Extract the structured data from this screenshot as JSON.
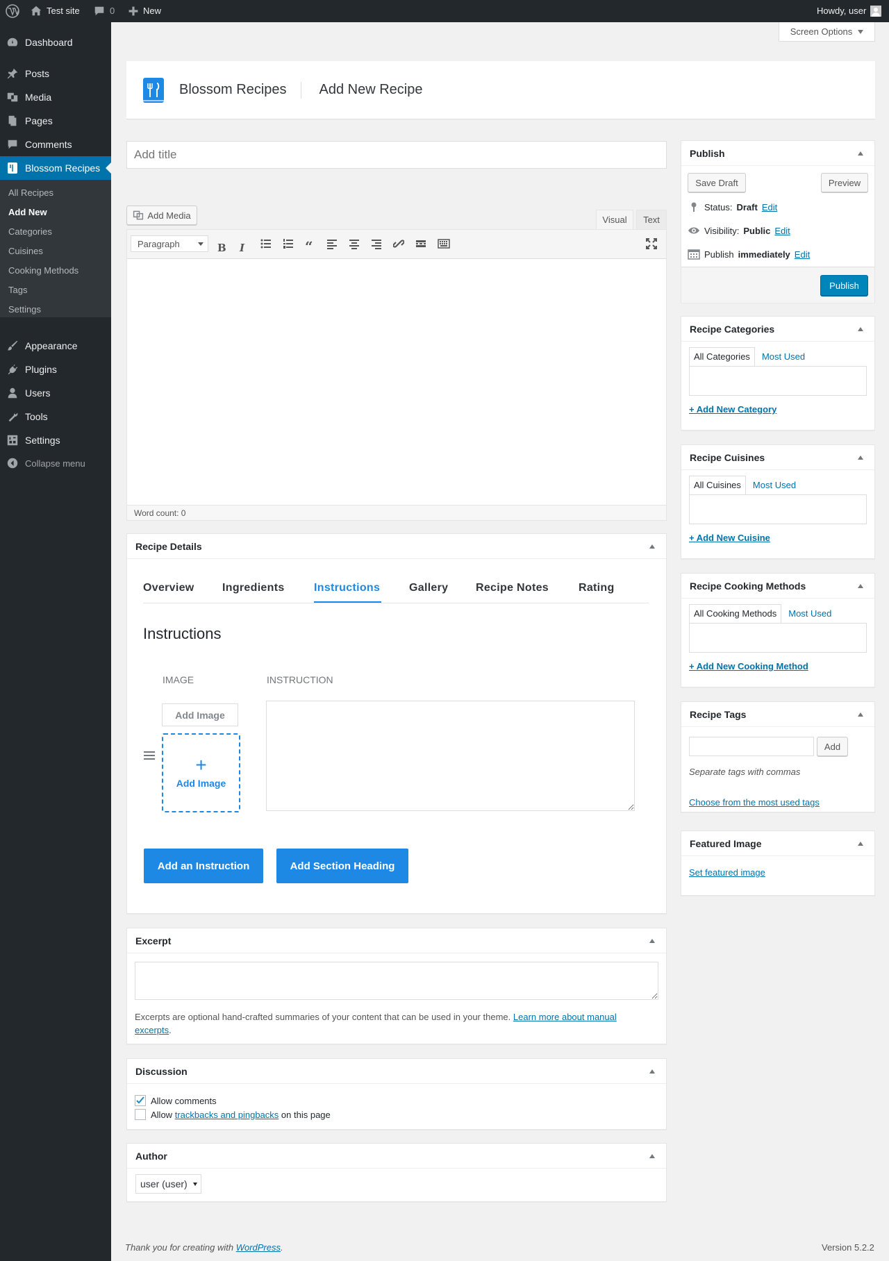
{
  "adminbar": {
    "wp_logo_icon": "wordpress-logo-icon",
    "site_name": "Test site",
    "comments_count": "0",
    "new_label": "New",
    "howdy": "Howdy, user"
  },
  "sidebar": {
    "items": [
      {
        "label": "Dashboard",
        "icon": "dashboard-icon"
      },
      {
        "label": "Posts",
        "icon": "pin-icon"
      },
      {
        "label": "Media",
        "icon": "media-icon"
      },
      {
        "label": "Pages",
        "icon": "pages-icon"
      },
      {
        "label": "Comments",
        "icon": "comments-icon"
      },
      {
        "label": "Blossom Recipes",
        "icon": "recipe-book-icon"
      },
      {
        "label": "Appearance",
        "icon": "brush-icon"
      },
      {
        "label": "Plugins",
        "icon": "plug-icon"
      },
      {
        "label": "Users",
        "icon": "users-icon"
      },
      {
        "label": "Tools",
        "icon": "wrench-icon"
      },
      {
        "label": "Settings",
        "icon": "settings-icon"
      }
    ],
    "submenu": [
      "All Recipes",
      "Add New",
      "Categories",
      "Cuisines",
      "Cooking Methods",
      "Tags",
      "Settings"
    ],
    "collapse": "Collapse menu"
  },
  "screen_options": "Screen Options",
  "header": {
    "plugin_name": "Blossom Recipes",
    "page_title": "Add New Recipe"
  },
  "title_placeholder": "Add title",
  "editor": {
    "add_media": "Add Media",
    "tab_visual": "Visual",
    "tab_text": "Text",
    "format_select": "Paragraph",
    "word_count": "Word count: 0"
  },
  "recipe_details": {
    "heading": "Recipe Details",
    "tabs": [
      "Overview",
      "Ingredients",
      "Instructions",
      "Gallery",
      "Recipe Notes",
      "Rating"
    ],
    "active_tab": "Instructions",
    "section_title": "Instructions",
    "col_image": "IMAGE",
    "col_instruction": "INSTRUCTION",
    "add_image_btn": "Add Image",
    "add_image_box": "Add Image",
    "add_instruction": "Add an Instruction",
    "add_section_heading": "Add Section Heading"
  },
  "excerpt": {
    "heading": "Excerpt",
    "help_text": "Excerpts are optional hand-crafted summaries of your content that can be used in your theme.",
    "link1": "Learn more about manual",
    "link2": "excerpts",
    "period": "."
  },
  "discussion": {
    "heading": "Discussion",
    "allow_comments": "Allow comments",
    "allow_prefix": "Allow",
    "trackbacks_link": "trackbacks and pingbacks",
    "allow_suffix": "on this page",
    "allow_comments_checked": true,
    "allow_pings_checked": false
  },
  "author": {
    "heading": "Author",
    "value": "user (user)"
  },
  "publish": {
    "heading": "Publish",
    "save_draft": "Save Draft",
    "preview": "Preview",
    "status_label": "Status:",
    "status_value": "Draft",
    "visibility_label": "Visibility:",
    "visibility_value": "Public",
    "publish_label": "Publish",
    "publish_value": "immediately",
    "edit": "Edit",
    "publish_btn": "Publish"
  },
  "categories": {
    "heading": "Recipe Categories",
    "tab_all": "All Categories",
    "tab_most": "Most Used",
    "add": "+ Add New Category"
  },
  "cuisines": {
    "heading": "Recipe Cuisines",
    "tab_all": "All Cuisines",
    "tab_most": "Most Used",
    "add": "+ Add New Cuisine"
  },
  "methods": {
    "heading": "Recipe Cooking Methods",
    "tab_all": "All Cooking Methods",
    "tab_most": "Most Used",
    "add": "+ Add New Cooking Method"
  },
  "tags": {
    "heading": "Recipe Tags",
    "add_btn": "Add",
    "help": "Separate tags with commas",
    "choose": "Choose from the most used tags"
  },
  "featured": {
    "heading": "Featured Image",
    "link": "Set featured image"
  },
  "footer": {
    "thanks_prefix": "Thank you for creating with",
    "wp_link": "WordPress",
    "period": ".",
    "version": "Version 5.2.2"
  },
  "colors": {
    "accent": "#0073aa",
    "admin_dark": "#23282d",
    "recipe_blue": "#1e88e5",
    "publish_blue": "#0085ba"
  }
}
